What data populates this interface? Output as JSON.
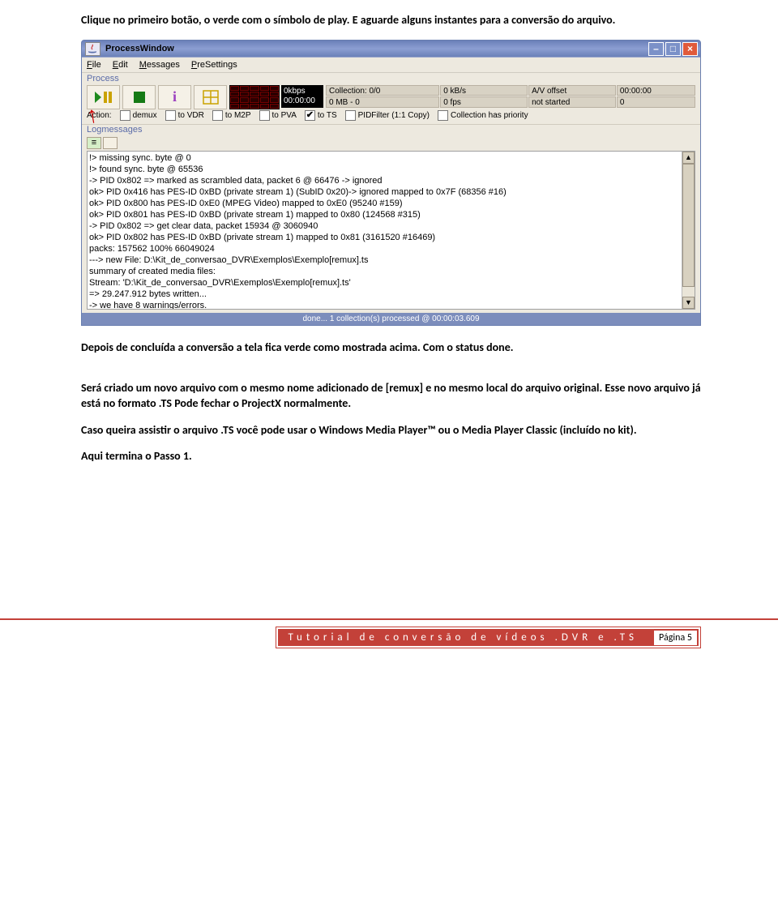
{
  "intro": "Clique no primeiro botão, o verde com o símbolo de play. E aguarde alguns instantes para a conversão do arquivo.",
  "after_img": "Depois de concluída a conversão a tela fica verde como mostrada acima. Com o status done.",
  "p3": "Será criado um novo arquivo com o mesmo nome adicionado de [remux] e no mesmo local do arquivo original. Esse novo arquivo já está no formato .TS  Pode fechar o ProjectX normalmente.",
  "p4": "Caso queira assistir o arquivo .TS você pode usar o Windows Media Player™ ou o Media Player Classic (incluído no kit).",
  "p5": "Aqui termina o Passo 1.",
  "window": {
    "title": "ProcessWindow",
    "menu": [
      "File",
      "Edit",
      "Messages",
      "PreSettings"
    ],
    "section_process": "Process",
    "kbps": "0kbps",
    "time": "00:00:00",
    "stats": {
      "collection": "Collection: 0/0",
      "kbs": "0 kB/s",
      "avoffset": "A/V offset",
      "avtime": "00:00:00",
      "mb": "0 MB - 0",
      "fps": "0 fps",
      "status": "not started",
      "zero": "0"
    },
    "action_label": "Action:",
    "checks": {
      "demux": "demux",
      "vdr": "to VDR",
      "m2p": "to M2P",
      "pva": "to PVA",
      "ts": "to TS",
      "pid": "PIDFilter (1:1 Copy)",
      "priority": "Collection has priority"
    },
    "section_log": "Logmessages",
    "lines": [
      "!> missing sync. byte @ 0",
      "!> found sync. byte @ 65536",
      "-> PID 0x802 => marked as scrambled data, packet 6 @ 66476 -> ignored",
      "ok> PID 0x416 has PES-ID 0xBD (private stream 1) (SubID 0x20)-> ignored mapped to 0x7F (68356 #16)",
      "ok> PID 0x800 has PES-ID 0xE0 (MPEG Video) mapped to 0xE0 (95240 #159)",
      "ok> PID 0x801 has PES-ID 0xBD (private stream 1) mapped to 0x80 (124568 #315)",
      "-> PID 0x802 => get clear data, packet 15934 @ 3060940",
      "ok> PID 0x802 has PES-ID 0xBD (private stream 1) mapped to 0x81 (3161520 #16469)",
      "packs: 157562 100% 66049024",
      "---> new File: D:\\Kit_de_conversao_DVR\\Exemplos\\Exemplo[remux].ts",
      "",
      "summary of created media files:",
      "Stream:                    'D:\\Kit_de_conversao_DVR\\Exemplos\\Exemplo[remux].ts'",
      "=> 29.247.912 bytes written...",
      "-> we have 8 warnings/errors."
    ],
    "statusbar": "done...   1 collection(s) processed @ 00:00:03.609"
  },
  "footer": {
    "title": "Tutorial de conversão de vídeos .DVR e .TS",
    "page": "Página 5"
  }
}
